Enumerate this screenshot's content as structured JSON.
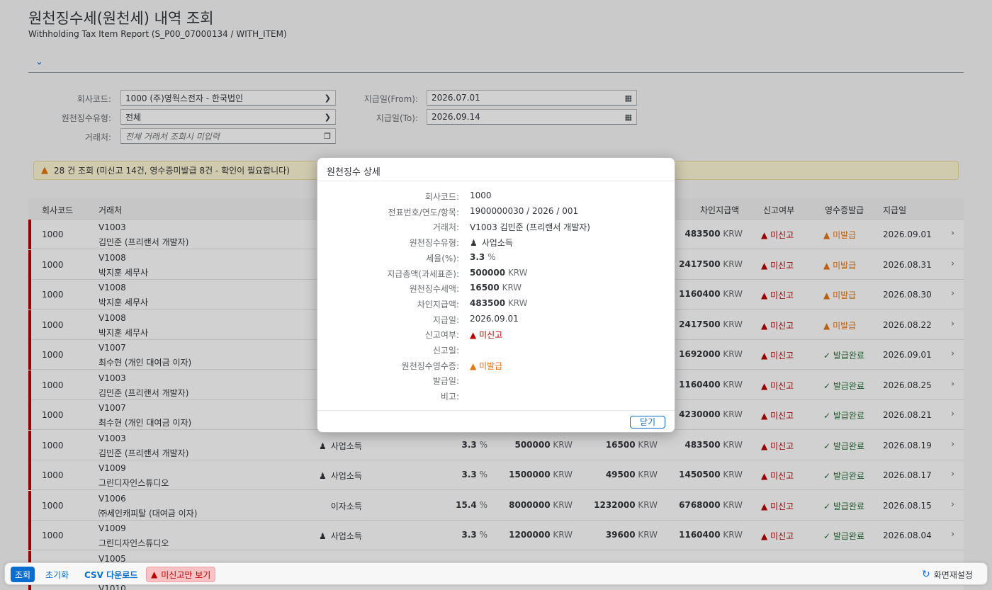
{
  "page": {
    "title": "원천징수세(원천세) 내역 조회",
    "subtitle": "Withholding Tax Item Report (S_P00_07000134 / WITH_ITEM)"
  },
  "filters": {
    "company_code_label": "회사코드:",
    "company_code_value": "1000 (주)영웍스전자 - 한국법인",
    "wht_type_label": "원천징수유형:",
    "wht_type_value": "전체",
    "vendor_label": "거래처:",
    "vendor_placeholder": "전체 거래처 조회시 미입력",
    "date_from_label": "지급일(From):",
    "date_from_value": "2026.07.01",
    "date_to_label": "지급일(To):",
    "date_to_value": "2026.09.14"
  },
  "message": "28 건 조회 (미신고 14건, 영수증미발급 8건 - 확인이 필요합니다)",
  "table": {
    "headers": {
      "company": "회사코드",
      "vendor": "거래처",
      "net": "차인지급액",
      "report": "신고여부",
      "receipt": "영수증발급",
      "date": "지급일"
    },
    "currency": "KRW",
    "pct": "%",
    "rows": [
      {
        "company": "1000",
        "vendor_id": "V1003",
        "vendor_name": "김민준 (프리랜서 개발자)",
        "type": "",
        "rate": "",
        "total": "",
        "tax": "",
        "net": "483500",
        "status": "미신고",
        "receipt": "미발급",
        "receipt_ok": false,
        "date": "2026.09.01"
      },
      {
        "company": "1000",
        "vendor_id": "V1008",
        "vendor_name": "박지훈 세무사",
        "type": "",
        "rate": "",
        "total": "",
        "tax": "",
        "net": "2417500",
        "status": "미신고",
        "receipt": "미발급",
        "receipt_ok": false,
        "date": "2026.08.31"
      },
      {
        "company": "1000",
        "vendor_id": "V1008",
        "vendor_name": "박지훈 세무사",
        "type": "",
        "rate": "",
        "total": "",
        "tax": "",
        "net": "1160400",
        "status": "미신고",
        "receipt": "미발급",
        "receipt_ok": false,
        "date": "2026.08.30"
      },
      {
        "company": "1000",
        "vendor_id": "V1008",
        "vendor_name": "박지훈 세무사",
        "type": "",
        "rate": "",
        "total": "",
        "tax": "",
        "net": "2417500",
        "status": "미신고",
        "receipt": "미발급",
        "receipt_ok": false,
        "date": "2026.08.22"
      },
      {
        "company": "1000",
        "vendor_id": "V1007",
        "vendor_name": "최수현 (개인 대여금 이자)",
        "type": "",
        "rate": "",
        "total": "",
        "tax": "",
        "net": "1692000",
        "status": "미신고",
        "receipt": "발급완료",
        "receipt_ok": true,
        "date": "2026.09.01"
      },
      {
        "company": "1000",
        "vendor_id": "V1003",
        "vendor_name": "김민준 (프리랜서 개발자)",
        "type": "",
        "rate": "",
        "total": "",
        "tax": "",
        "net": "1160400",
        "status": "미신고",
        "receipt": "발급완료",
        "receipt_ok": true,
        "date": "2026.08.25"
      },
      {
        "company": "1000",
        "vendor_id": "V1007",
        "vendor_name": "최수현 (개인 대여금 이자)",
        "type": "",
        "rate": "",
        "total": "",
        "tax": "",
        "net": "4230000",
        "status": "미신고",
        "receipt": "발급완료",
        "receipt_ok": true,
        "date": "2026.08.21"
      },
      {
        "company": "1000",
        "vendor_id": "V1003",
        "vendor_name": "김민준 (프리랜서 개발자)",
        "type": "사업소득",
        "rate": "3.3",
        "total": "500000",
        "tax": "16500",
        "net": "483500",
        "status": "미신고",
        "receipt": "발급완료",
        "receipt_ok": true,
        "date": "2026.08.19"
      },
      {
        "company": "1000",
        "vendor_id": "V1009",
        "vendor_name": "그린디자인스튜디오",
        "type": "사업소득",
        "rate": "3.3",
        "total": "1500000",
        "tax": "49500",
        "net": "1450500",
        "status": "미신고",
        "receipt": "발급완료",
        "receipt_ok": true,
        "date": "2026.08.17"
      },
      {
        "company": "1000",
        "vendor_id": "V1006",
        "vendor_name": "㈜세인캐피탈 (대여금 이자)",
        "type": "이자소득",
        "rate": "15.4",
        "total": "8000000",
        "tax": "1232000",
        "net": "6768000",
        "status": "미신고",
        "receipt": "발급완료",
        "receipt_ok": true,
        "date": "2026.08.15"
      },
      {
        "company": "1000",
        "vendor_id": "V1009",
        "vendor_name": "그린디자인스튜디오",
        "type": "사업소득",
        "rate": "3.3",
        "total": "1200000",
        "tax": "39600",
        "net": "1160400",
        "status": "미신고",
        "receipt": "발급완료",
        "receipt_ok": true,
        "date": "2026.08.04"
      },
      {
        "company": "",
        "vendor_id": "V1005",
        "vendor_name": "",
        "type": "",
        "rate": "",
        "total": "",
        "tax": "",
        "net": "",
        "status": "",
        "receipt": "",
        "receipt_ok": true,
        "date": ""
      },
      {
        "company": "",
        "vendor_id": "V1010",
        "vendor_name": "",
        "type": "",
        "rate": "",
        "total": "",
        "tax": "",
        "net": "",
        "status": "",
        "receipt": "",
        "receipt_ok": true,
        "date": ""
      }
    ]
  },
  "footer": {
    "search": "조회",
    "reset": "초기화",
    "csv": "CSV 다운로드",
    "unreported_only": "미신고만 보기",
    "layout_reset": "화면재설정"
  },
  "dialog": {
    "title": "원천징수 상세",
    "close": "닫기",
    "fields": [
      {
        "label": "회사코드:",
        "value": "1000",
        "bold": "",
        "unit": ""
      },
      {
        "label": "전표번호/연도/항목:",
        "value": "1900000030 / 2026 / 001",
        "bold": "",
        "unit": ""
      },
      {
        "label": "거래처:",
        "value": "V1003 김민준 (프리랜서 개발자)",
        "bold": "",
        "unit": ""
      },
      {
        "label": "원천징수유형:",
        "value": "사업소득",
        "bold": "",
        "unit": "",
        "icon": "person-icon"
      },
      {
        "label": "세율(%):",
        "value": "",
        "bold": "3.3",
        "unit": "%"
      },
      {
        "label": "지급총액(과세표준):",
        "value": "",
        "bold": "500000",
        "unit": "KRW"
      },
      {
        "label": "원천징수세액:",
        "value": "",
        "bold": "16500",
        "unit": "KRW"
      },
      {
        "label": "차인지급액:",
        "value": "",
        "bold": "483500",
        "unit": "KRW"
      },
      {
        "label": "지급일:",
        "value": "2026.09.01",
        "bold": "",
        "unit": ""
      },
      {
        "label": "신고여부:",
        "value": "미신고",
        "bold": "",
        "unit": "",
        "status": "red"
      },
      {
        "label": "신고일:",
        "value": "",
        "bold": "",
        "unit": ""
      },
      {
        "label": "원천징수영수증:",
        "value": "미발급",
        "bold": "",
        "unit": "",
        "status": "orange"
      },
      {
        "label": "발급일:",
        "value": "",
        "bold": "",
        "unit": ""
      },
      {
        "label": "비고:",
        "value": "",
        "bold": "",
        "unit": ""
      }
    ]
  },
  "colors": {
    "accent": "#0a6ed1",
    "error": "#bb0000",
    "warning": "#e9730c",
    "success": "#256f3a"
  }
}
